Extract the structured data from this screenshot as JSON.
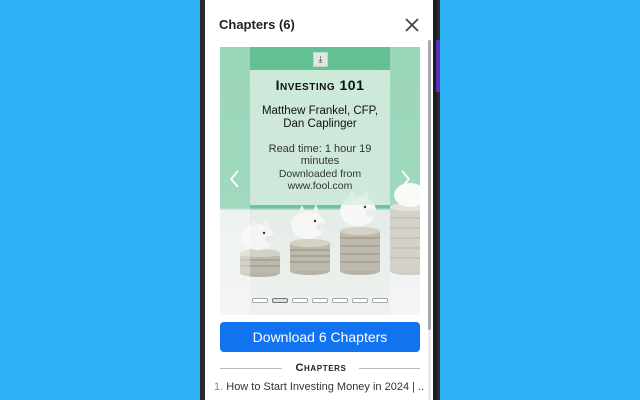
{
  "header": {
    "title": "Chapters (6)"
  },
  "carousel": {
    "title": "Investing 101",
    "author": "Matthew Frankel, CFP, Dan Caplinger",
    "read_time": "Read time: 1 hour 19 minutes",
    "source": "Downloaded from www.fool.com",
    "slide_count": 7,
    "active_slide": 1,
    "background_color": "#5ebd8f"
  },
  "actions": {
    "download_label": "Download 6 Chapters",
    "accent_color": "#1273f0"
  },
  "chapters": {
    "heading": "Chapters",
    "items": [
      {
        "number": "1.",
        "title": "How to Start Investing Money in 2024 | ..."
      }
    ]
  },
  "icons": {
    "close": "close-icon",
    "prev": "chevron-left-icon",
    "next": "chevron-right-icon",
    "slide_download": "download-icon"
  }
}
